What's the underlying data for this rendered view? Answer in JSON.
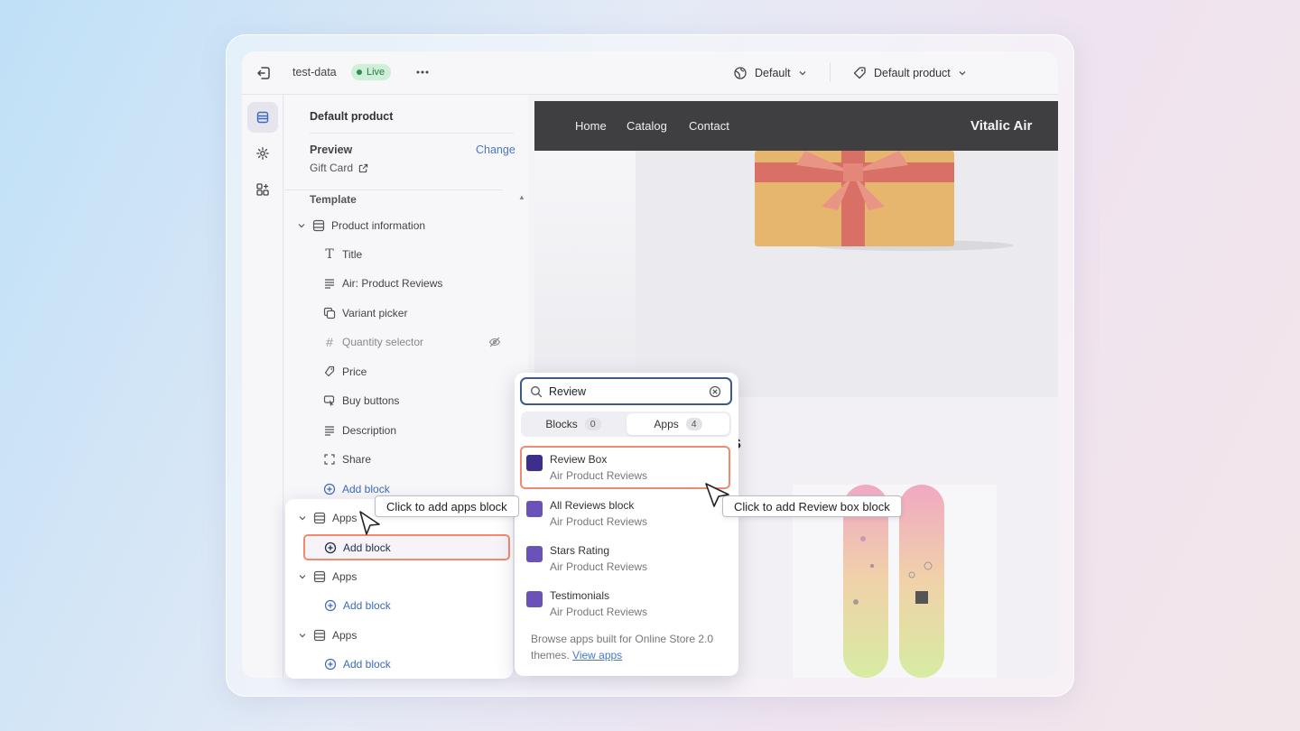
{
  "topbar": {
    "store_name": "test-data",
    "status": "Live",
    "theme": "Default",
    "template": "Default product"
  },
  "panel": {
    "title": "Default product",
    "preview_label": "Preview",
    "change_label": "Change",
    "preview_value": "Gift Card",
    "template_label": "Template",
    "section": "Product information",
    "blocks": [
      {
        "label": "Title",
        "icon": "title-icon"
      },
      {
        "label": "Air: Product Reviews",
        "icon": "text-lines-icon"
      },
      {
        "label": "Variant picker",
        "icon": "variant-icon"
      },
      {
        "label": "Quantity selector",
        "icon": "hash-icon",
        "hidden": true
      },
      {
        "label": "Price",
        "icon": "price-tag-icon"
      },
      {
        "label": "Buy buttons",
        "icon": "cursor-click-icon"
      },
      {
        "label": "Description",
        "icon": "text-lines-icon"
      },
      {
        "label": "Share",
        "icon": "share-frame-icon"
      }
    ],
    "add_block": "Add block",
    "apps_sections": [
      {
        "label": "Apps",
        "add_block": "Add block"
      },
      {
        "label": "Apps",
        "add_block": "Add block"
      },
      {
        "label": "Apps",
        "add_block": "Add block"
      }
    ]
  },
  "store": {
    "nav": [
      "Home",
      "Catalog",
      "Contact"
    ],
    "brand": "Vitalic Air",
    "partial_text": "s"
  },
  "search": {
    "query": "Review",
    "tabs": [
      {
        "label": "Blocks",
        "count": "0"
      },
      {
        "label": "Apps",
        "count": "4"
      }
    ],
    "results": [
      {
        "name": "Review Box",
        "app": "Air Product Reviews"
      },
      {
        "name": "All Reviews block",
        "app": "Air Product Reviews"
      },
      {
        "name": "Stars Rating",
        "app": "Air Product Reviews"
      },
      {
        "name": "Testimonials",
        "app": "Air Product Reviews"
      }
    ],
    "browse_text": "Browse apps built for Online Store 2.0 themes.",
    "browse_link": "View apps"
  },
  "tooltips": {
    "apps_block": "Click to add apps block",
    "review_box": "Click to add Review box block"
  },
  "colors": {
    "highlight": "#f08a70",
    "link": "#4a78c4",
    "live_badge": "#cdf0d6",
    "store_nav": "#3f3e40"
  }
}
